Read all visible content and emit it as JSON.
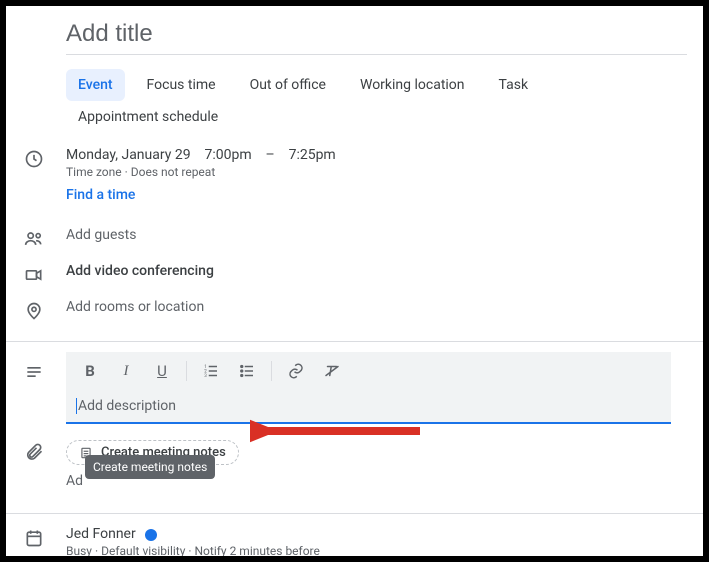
{
  "title_placeholder": "Add title",
  "tabs": [
    "Event",
    "Focus time",
    "Out of office",
    "Working location",
    "Task",
    "Appointment schedule"
  ],
  "datetime": {
    "date": "Monday, January 29",
    "start": "7:00pm",
    "sep": "–",
    "end": "7:25pm",
    "tz": "Time zone",
    "repeat": "Does not repeat"
  },
  "find_time": "Find a time",
  "guests_placeholder": "Add guests",
  "video_label": "Add video conferencing",
  "location_placeholder": "Add rooms or location",
  "desc_placeholder": "Add description",
  "create_notes_chip": "Create meeting notes",
  "tooltip": "Create meeting notes",
  "add_attachment": "Ad",
  "owner": {
    "name": "Jed Fonner",
    "busy": "Busy",
    "visibility": "Default visibility",
    "notify": "Notify 2 minutes before"
  }
}
